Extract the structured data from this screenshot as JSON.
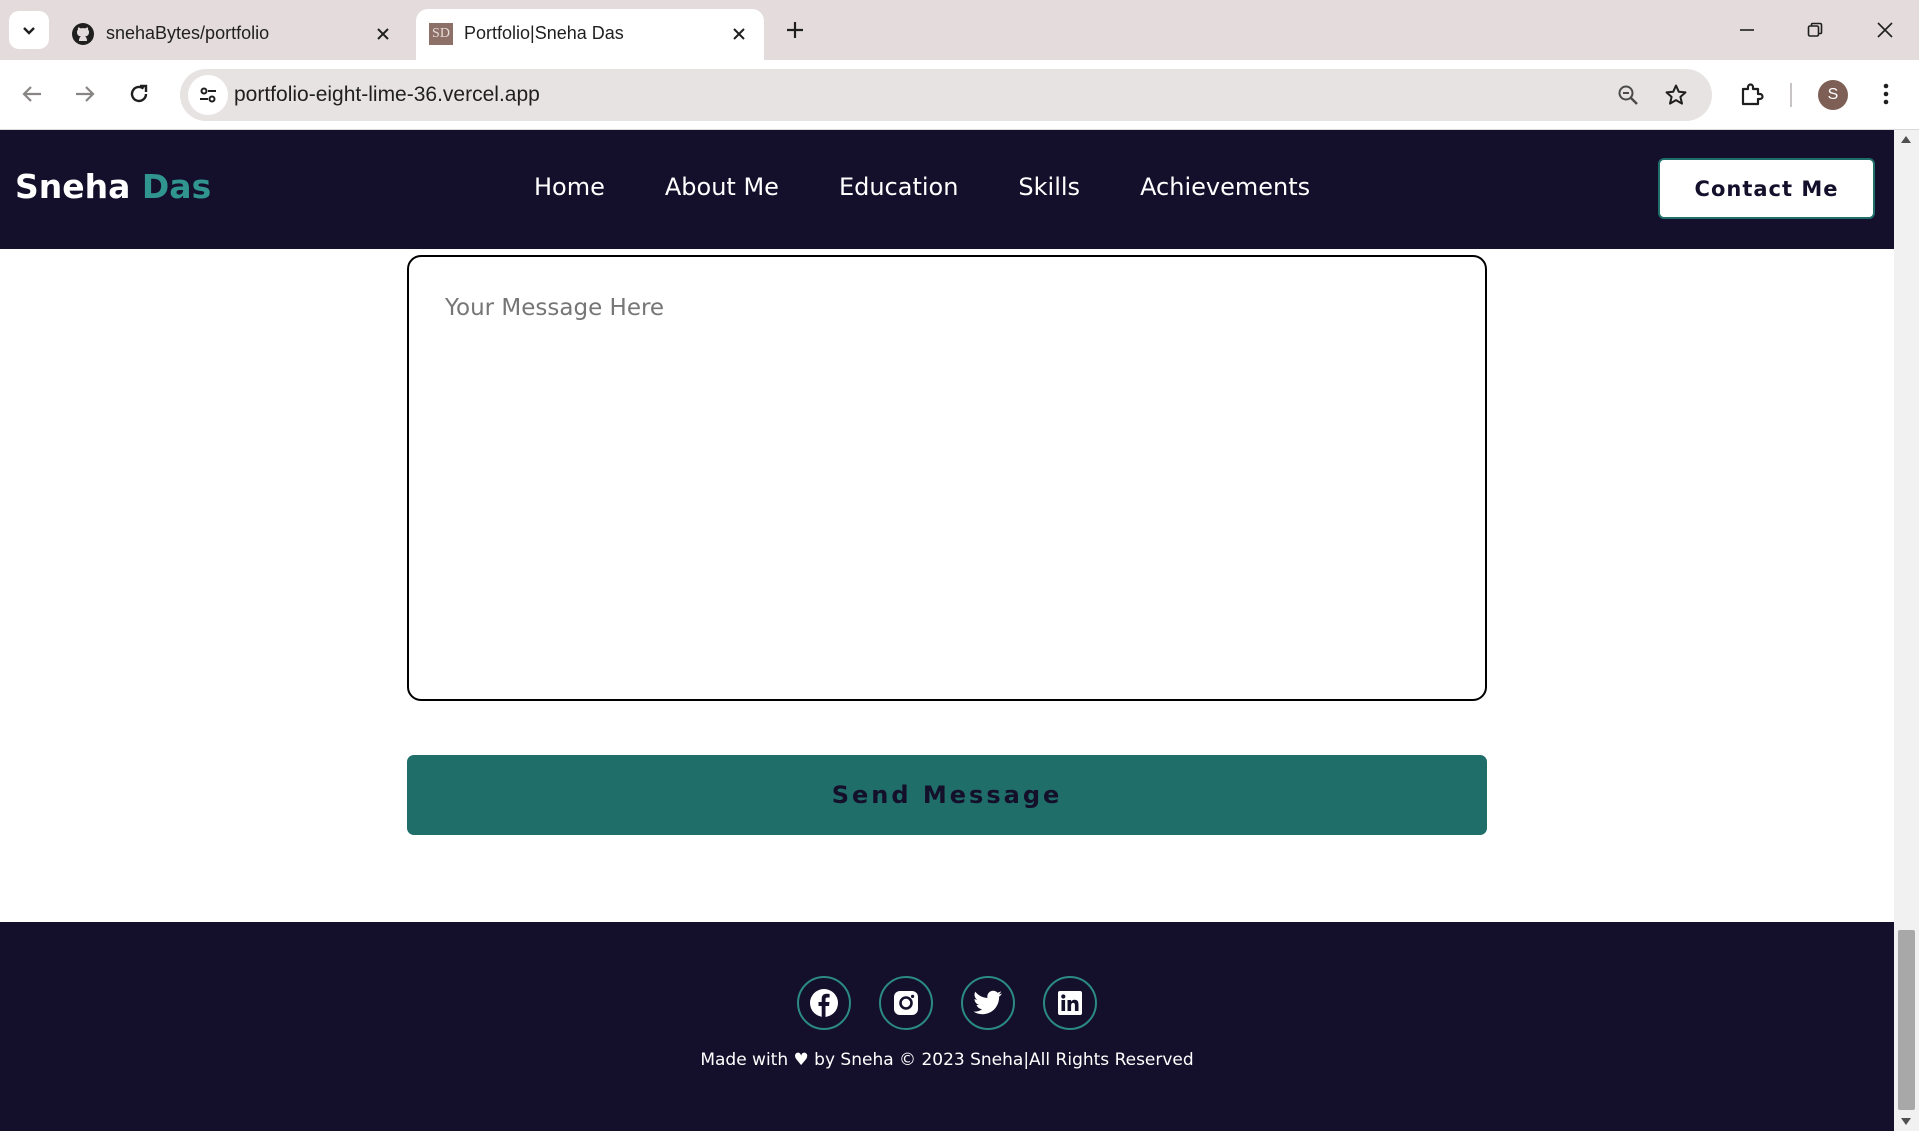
{
  "browser": {
    "tabs": [
      {
        "title": "snehaBytes/portfolio",
        "active": false
      },
      {
        "title": "Portfolio|Sneha Das",
        "active": true,
        "favicon_text": "SD"
      }
    ],
    "address": "portfolio-eight-lime-36.vercel.app",
    "profile_initial": "S"
  },
  "site": {
    "logo_first": "Sneha",
    "logo_second": "Das",
    "nav_links": [
      "Home",
      "About Me",
      "Education",
      "Skills",
      "Achievements"
    ],
    "contact_button": "Contact Me"
  },
  "contact_form": {
    "message_placeholder": "Your Message Here",
    "message_value": "",
    "send_button": "Send Message"
  },
  "footer": {
    "socials": [
      "facebook-icon",
      "instagram-icon",
      "twitter-icon",
      "linkedin-icon"
    ],
    "text": "Made with ♥ by Sneha © 2023 Sneha|All Rights Reserved"
  },
  "colors": {
    "nav_bg": "#140f2a",
    "accent": "#31958f",
    "button_teal": "#1f6e6a"
  }
}
